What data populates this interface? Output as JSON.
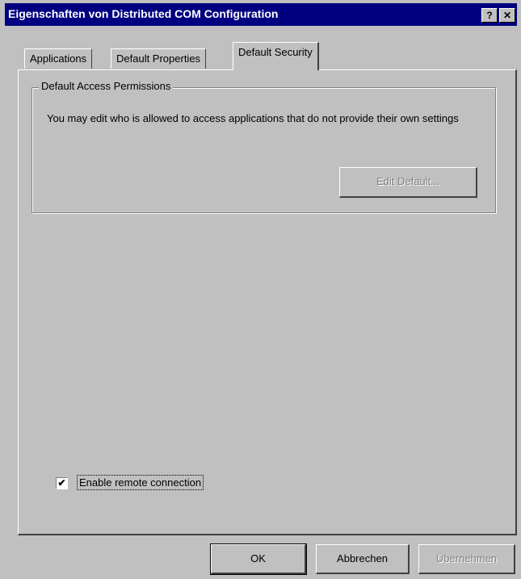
{
  "window": {
    "title": "Eigenschaften von Distributed COM Configuration",
    "help_glyph": "?",
    "close_glyph": "✕"
  },
  "tabs": [
    {
      "label": "Applications"
    },
    {
      "label": "Default Properties"
    },
    {
      "label": "Default Security"
    }
  ],
  "access_group": {
    "legend": "Default Access Permissions",
    "description": "You may edit who is allowed to access applications that do not provide their own settings",
    "edit_button": "Edit Default..."
  },
  "remote": {
    "checked_glyph": "✔",
    "label": "Enable remote connection"
  },
  "buttons": {
    "ok": "OK",
    "cancel": "Abbrechen",
    "apply": "Übernehmen"
  }
}
